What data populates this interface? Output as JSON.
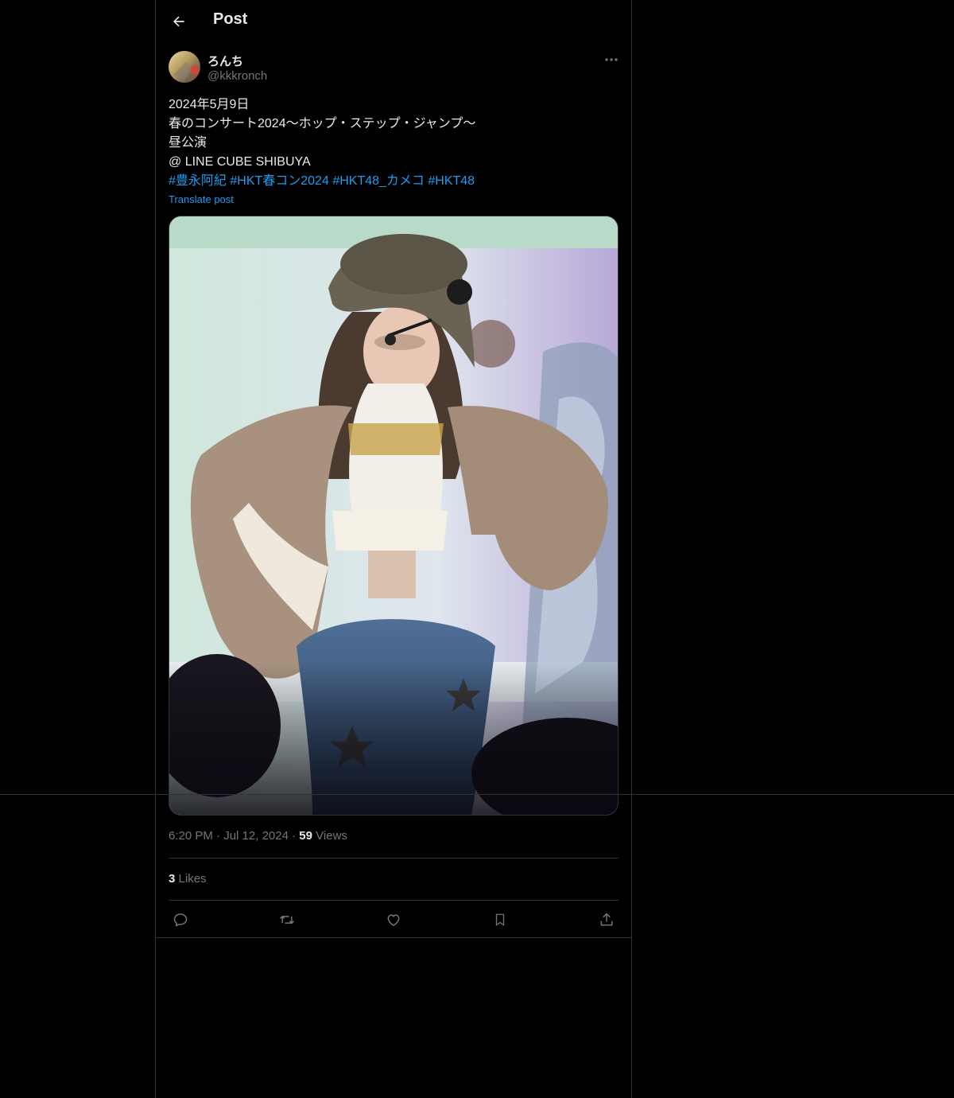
{
  "header": {
    "title": "Post"
  },
  "author": {
    "display_name": "ろんち",
    "handle": "@kkkronch"
  },
  "post": {
    "lines": [
      "2024年5月9日",
      "春のコンサート2024〜ホップ・ステップ・ジャンプ〜",
      "昼公演",
      "@ LINE CUBE SHIBUYA"
    ],
    "hashtags": [
      "#豊永阿紀",
      "#HKT春コン2024",
      "#HKT48_カメコ",
      "#HKT48"
    ],
    "translate_label": "Translate post"
  },
  "meta": {
    "time": "6:20 PM",
    "separator": "·",
    "date": "Jul 12, 2024",
    "views_count": "59",
    "views_label": "Views"
  },
  "stats": {
    "likes_count": "3",
    "likes_label": "Likes"
  },
  "icons": {
    "back": "arrow-left-icon",
    "more": "more-horizontal-icon",
    "reply": "reply-icon",
    "repost": "repost-icon",
    "like": "heart-icon",
    "bookmark": "bookmark-icon",
    "share": "share-icon"
  },
  "colors": {
    "background": "#000000",
    "text": "#e7e9ea",
    "secondary": "#71767b",
    "accent": "#1d9bf0",
    "border": "#2f3336"
  }
}
